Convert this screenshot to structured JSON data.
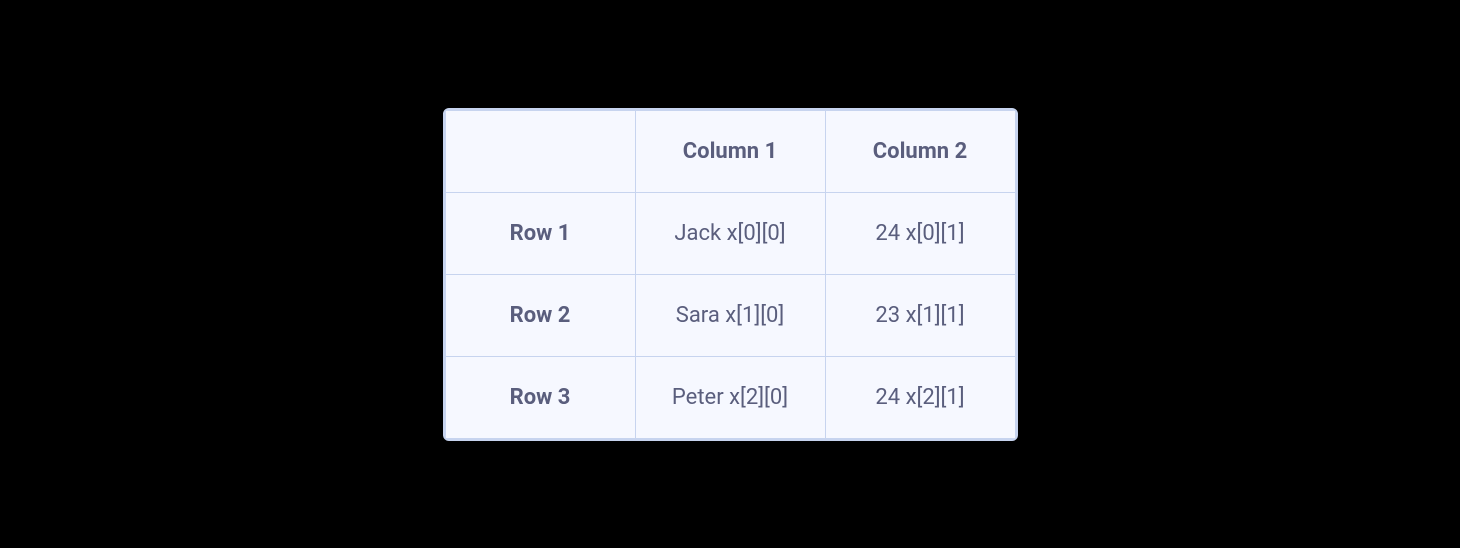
{
  "table": {
    "columns": [
      "Column 1",
      "Column 2"
    ],
    "rows": [
      {
        "label": "Row 1",
        "cells": [
          "Jack x[0][0]",
          "24 x[0][1]"
        ]
      },
      {
        "label": "Row 2",
        "cells": [
          "Sara x[1][0]",
          "23 x[1][1]"
        ]
      },
      {
        "label": "Row 3",
        "cells": [
          "Peter x[2][0]",
          "24 x[2][1]"
        ]
      }
    ]
  }
}
